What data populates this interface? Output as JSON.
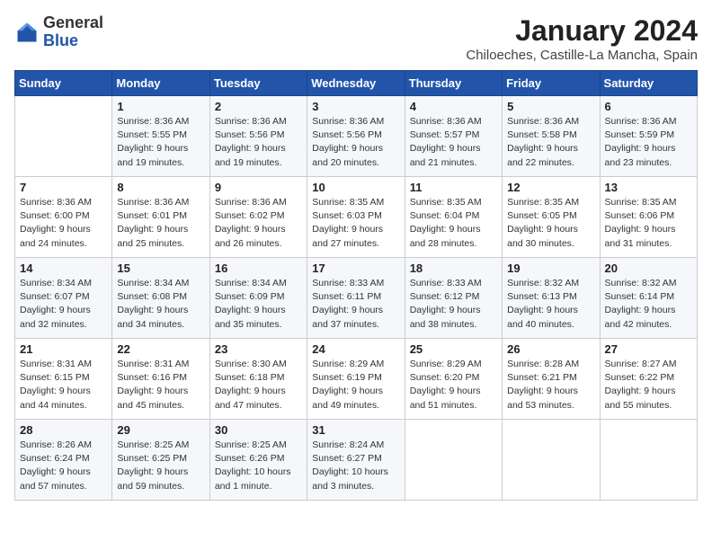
{
  "logo": {
    "general": "General",
    "blue": "Blue"
  },
  "header": {
    "month_year": "January 2024",
    "location": "Chiloeches, Castille-La Mancha, Spain"
  },
  "weekdays": [
    "Sunday",
    "Monday",
    "Tuesday",
    "Wednesday",
    "Thursday",
    "Friday",
    "Saturday"
  ],
  "weeks": [
    [
      {
        "day": "",
        "sunrise": "",
        "sunset": "",
        "daylight": ""
      },
      {
        "day": "1",
        "sunrise": "Sunrise: 8:36 AM",
        "sunset": "Sunset: 5:55 PM",
        "daylight": "Daylight: 9 hours and 19 minutes."
      },
      {
        "day": "2",
        "sunrise": "Sunrise: 8:36 AM",
        "sunset": "Sunset: 5:56 PM",
        "daylight": "Daylight: 9 hours and 19 minutes."
      },
      {
        "day": "3",
        "sunrise": "Sunrise: 8:36 AM",
        "sunset": "Sunset: 5:56 PM",
        "daylight": "Daylight: 9 hours and 20 minutes."
      },
      {
        "day": "4",
        "sunrise": "Sunrise: 8:36 AM",
        "sunset": "Sunset: 5:57 PM",
        "daylight": "Daylight: 9 hours and 21 minutes."
      },
      {
        "day": "5",
        "sunrise": "Sunrise: 8:36 AM",
        "sunset": "Sunset: 5:58 PM",
        "daylight": "Daylight: 9 hours and 22 minutes."
      },
      {
        "day": "6",
        "sunrise": "Sunrise: 8:36 AM",
        "sunset": "Sunset: 5:59 PM",
        "daylight": "Daylight: 9 hours and 23 minutes."
      }
    ],
    [
      {
        "day": "7",
        "sunrise": "Sunrise: 8:36 AM",
        "sunset": "Sunset: 6:00 PM",
        "daylight": "Daylight: 9 hours and 24 minutes."
      },
      {
        "day": "8",
        "sunrise": "Sunrise: 8:36 AM",
        "sunset": "Sunset: 6:01 PM",
        "daylight": "Daylight: 9 hours and 25 minutes."
      },
      {
        "day": "9",
        "sunrise": "Sunrise: 8:36 AM",
        "sunset": "Sunset: 6:02 PM",
        "daylight": "Daylight: 9 hours and 26 minutes."
      },
      {
        "day": "10",
        "sunrise": "Sunrise: 8:35 AM",
        "sunset": "Sunset: 6:03 PM",
        "daylight": "Daylight: 9 hours and 27 minutes."
      },
      {
        "day": "11",
        "sunrise": "Sunrise: 8:35 AM",
        "sunset": "Sunset: 6:04 PM",
        "daylight": "Daylight: 9 hours and 28 minutes."
      },
      {
        "day": "12",
        "sunrise": "Sunrise: 8:35 AM",
        "sunset": "Sunset: 6:05 PM",
        "daylight": "Daylight: 9 hours and 30 minutes."
      },
      {
        "day": "13",
        "sunrise": "Sunrise: 8:35 AM",
        "sunset": "Sunset: 6:06 PM",
        "daylight": "Daylight: 9 hours and 31 minutes."
      }
    ],
    [
      {
        "day": "14",
        "sunrise": "Sunrise: 8:34 AM",
        "sunset": "Sunset: 6:07 PM",
        "daylight": "Daylight: 9 hours and 32 minutes."
      },
      {
        "day": "15",
        "sunrise": "Sunrise: 8:34 AM",
        "sunset": "Sunset: 6:08 PM",
        "daylight": "Daylight: 9 hours and 34 minutes."
      },
      {
        "day": "16",
        "sunrise": "Sunrise: 8:34 AM",
        "sunset": "Sunset: 6:09 PM",
        "daylight": "Daylight: 9 hours and 35 minutes."
      },
      {
        "day": "17",
        "sunrise": "Sunrise: 8:33 AM",
        "sunset": "Sunset: 6:11 PM",
        "daylight": "Daylight: 9 hours and 37 minutes."
      },
      {
        "day": "18",
        "sunrise": "Sunrise: 8:33 AM",
        "sunset": "Sunset: 6:12 PM",
        "daylight": "Daylight: 9 hours and 38 minutes."
      },
      {
        "day": "19",
        "sunrise": "Sunrise: 8:32 AM",
        "sunset": "Sunset: 6:13 PM",
        "daylight": "Daylight: 9 hours and 40 minutes."
      },
      {
        "day": "20",
        "sunrise": "Sunrise: 8:32 AM",
        "sunset": "Sunset: 6:14 PM",
        "daylight": "Daylight: 9 hours and 42 minutes."
      }
    ],
    [
      {
        "day": "21",
        "sunrise": "Sunrise: 8:31 AM",
        "sunset": "Sunset: 6:15 PM",
        "daylight": "Daylight: 9 hours and 44 minutes."
      },
      {
        "day": "22",
        "sunrise": "Sunrise: 8:31 AM",
        "sunset": "Sunset: 6:16 PM",
        "daylight": "Daylight: 9 hours and 45 minutes."
      },
      {
        "day": "23",
        "sunrise": "Sunrise: 8:30 AM",
        "sunset": "Sunset: 6:18 PM",
        "daylight": "Daylight: 9 hours and 47 minutes."
      },
      {
        "day": "24",
        "sunrise": "Sunrise: 8:29 AM",
        "sunset": "Sunset: 6:19 PM",
        "daylight": "Daylight: 9 hours and 49 minutes."
      },
      {
        "day": "25",
        "sunrise": "Sunrise: 8:29 AM",
        "sunset": "Sunset: 6:20 PM",
        "daylight": "Daylight: 9 hours and 51 minutes."
      },
      {
        "day": "26",
        "sunrise": "Sunrise: 8:28 AM",
        "sunset": "Sunset: 6:21 PM",
        "daylight": "Daylight: 9 hours and 53 minutes."
      },
      {
        "day": "27",
        "sunrise": "Sunrise: 8:27 AM",
        "sunset": "Sunset: 6:22 PM",
        "daylight": "Daylight: 9 hours and 55 minutes."
      }
    ],
    [
      {
        "day": "28",
        "sunrise": "Sunrise: 8:26 AM",
        "sunset": "Sunset: 6:24 PM",
        "daylight": "Daylight: 9 hours and 57 minutes."
      },
      {
        "day": "29",
        "sunrise": "Sunrise: 8:25 AM",
        "sunset": "Sunset: 6:25 PM",
        "daylight": "Daylight: 9 hours and 59 minutes."
      },
      {
        "day": "30",
        "sunrise": "Sunrise: 8:25 AM",
        "sunset": "Sunset: 6:26 PM",
        "daylight": "Daylight: 10 hours and 1 minute."
      },
      {
        "day": "31",
        "sunrise": "Sunrise: 8:24 AM",
        "sunset": "Sunset: 6:27 PM",
        "daylight": "Daylight: 10 hours and 3 minutes."
      },
      {
        "day": "",
        "sunrise": "",
        "sunset": "",
        "daylight": ""
      },
      {
        "day": "",
        "sunrise": "",
        "sunset": "",
        "daylight": ""
      },
      {
        "day": "",
        "sunrise": "",
        "sunset": "",
        "daylight": ""
      }
    ]
  ]
}
